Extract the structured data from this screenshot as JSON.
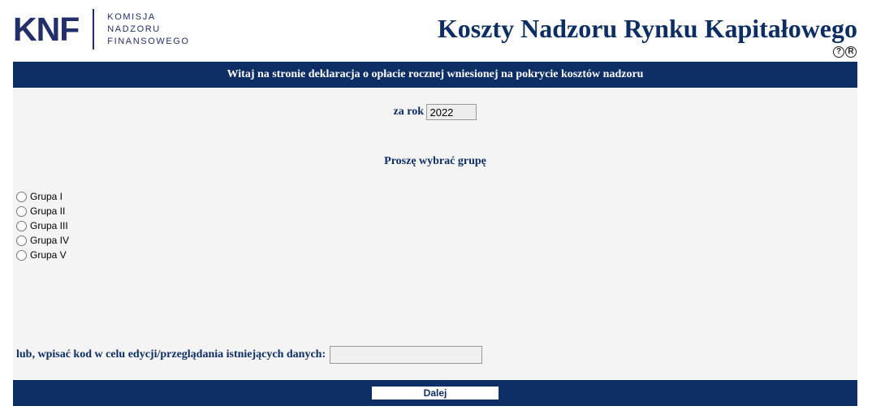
{
  "header": {
    "logo_mark": "KNF",
    "logo_lines": [
      "KOMISJA",
      "NADZORU",
      "FINANSOWEGO"
    ],
    "title": "Koszty Nadzoru Rynku Kapitałowego",
    "icons": [
      "help-icon",
      "registered-icon"
    ],
    "help_glyph": "?",
    "registered_glyph": "R"
  },
  "banner": {
    "text": "Witaj na stronie deklaracja o opłacie rocznej wniesionej na pokrycie kosztów nadzoru"
  },
  "form": {
    "year_label": "za rok",
    "year_value": "2022",
    "group_prompt": "Proszę wybrać grupę",
    "groups": [
      "Grupa I",
      "Grupa II",
      "Grupa III",
      "Grupa IV",
      "Grupa V"
    ],
    "code_label": "lub, wpisać kod w celu edycji/przeglądania istniejących danych:",
    "code_value": ""
  },
  "footer": {
    "next_label": "Dalej"
  },
  "colors": {
    "navy": "#0d2e64",
    "logo": "#232f6b",
    "panel": "#f4f4f4"
  }
}
